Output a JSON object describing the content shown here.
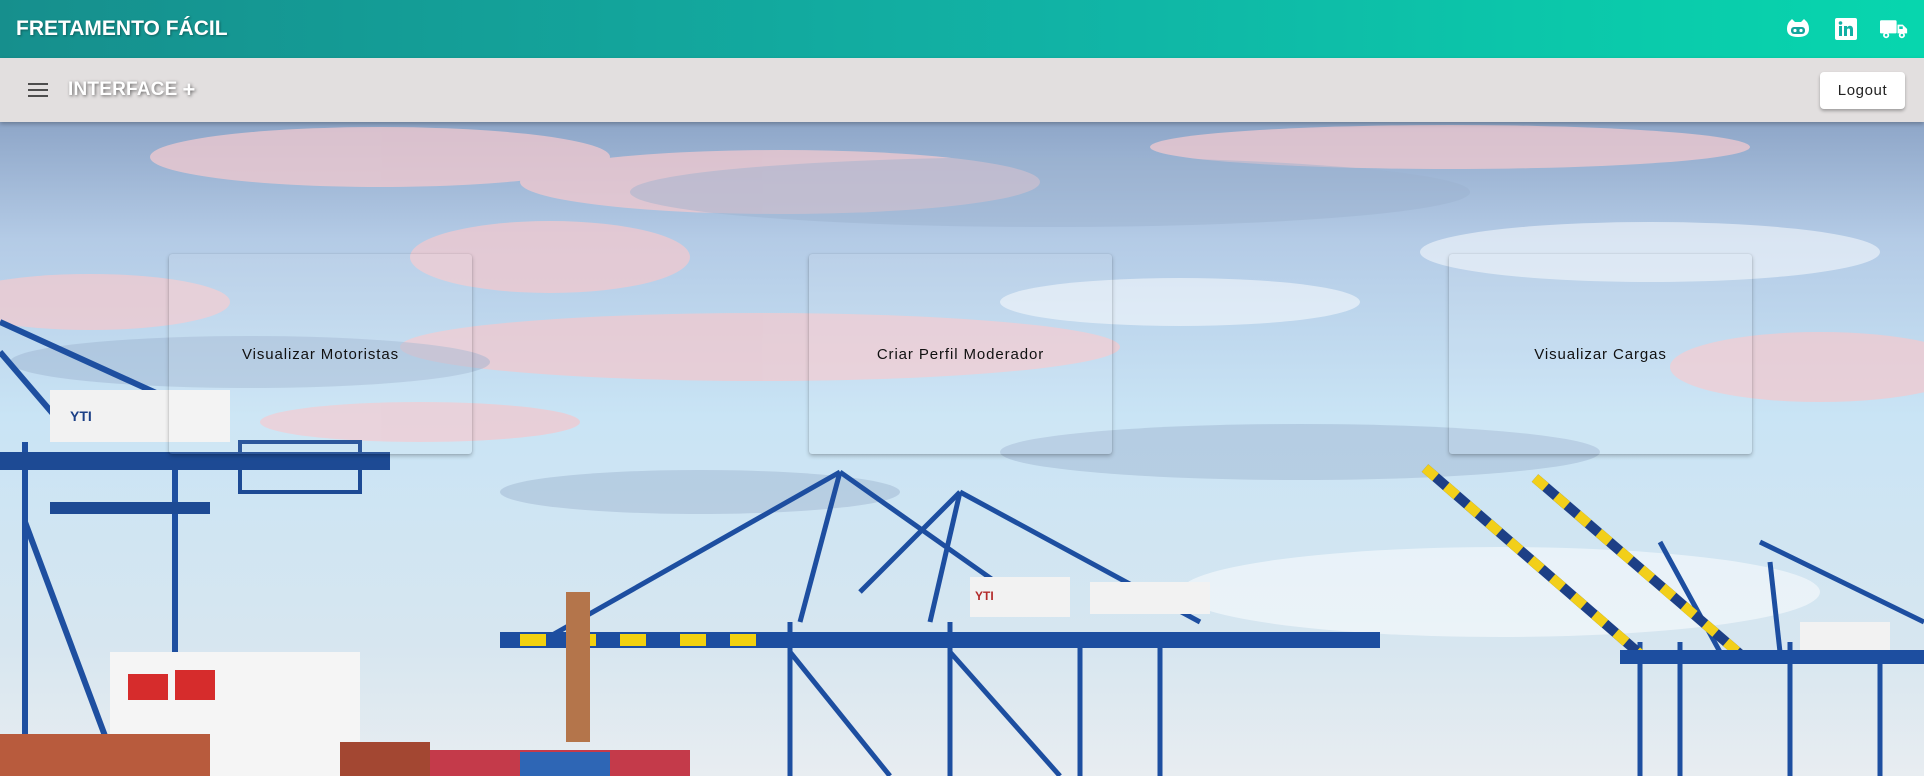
{
  "header": {
    "brand": "FRETAMENTO FÁCIL",
    "icons": [
      "github-icon",
      "linkedin-icon",
      "truck-icon"
    ],
    "gradient": [
      "#168f8d",
      "#07d6ae"
    ]
  },
  "subbar": {
    "title": "INTERFACE",
    "add_label": "+",
    "logout_label": "Logout",
    "background": "#e2dfdf"
  },
  "cards": [
    {
      "label": "Visualizar Motoristas"
    },
    {
      "label": "Criar Perfil Moderador"
    },
    {
      "label": "Visualizar Cargas"
    }
  ],
  "background": {
    "description_icon": "port-cranes-background"
  }
}
